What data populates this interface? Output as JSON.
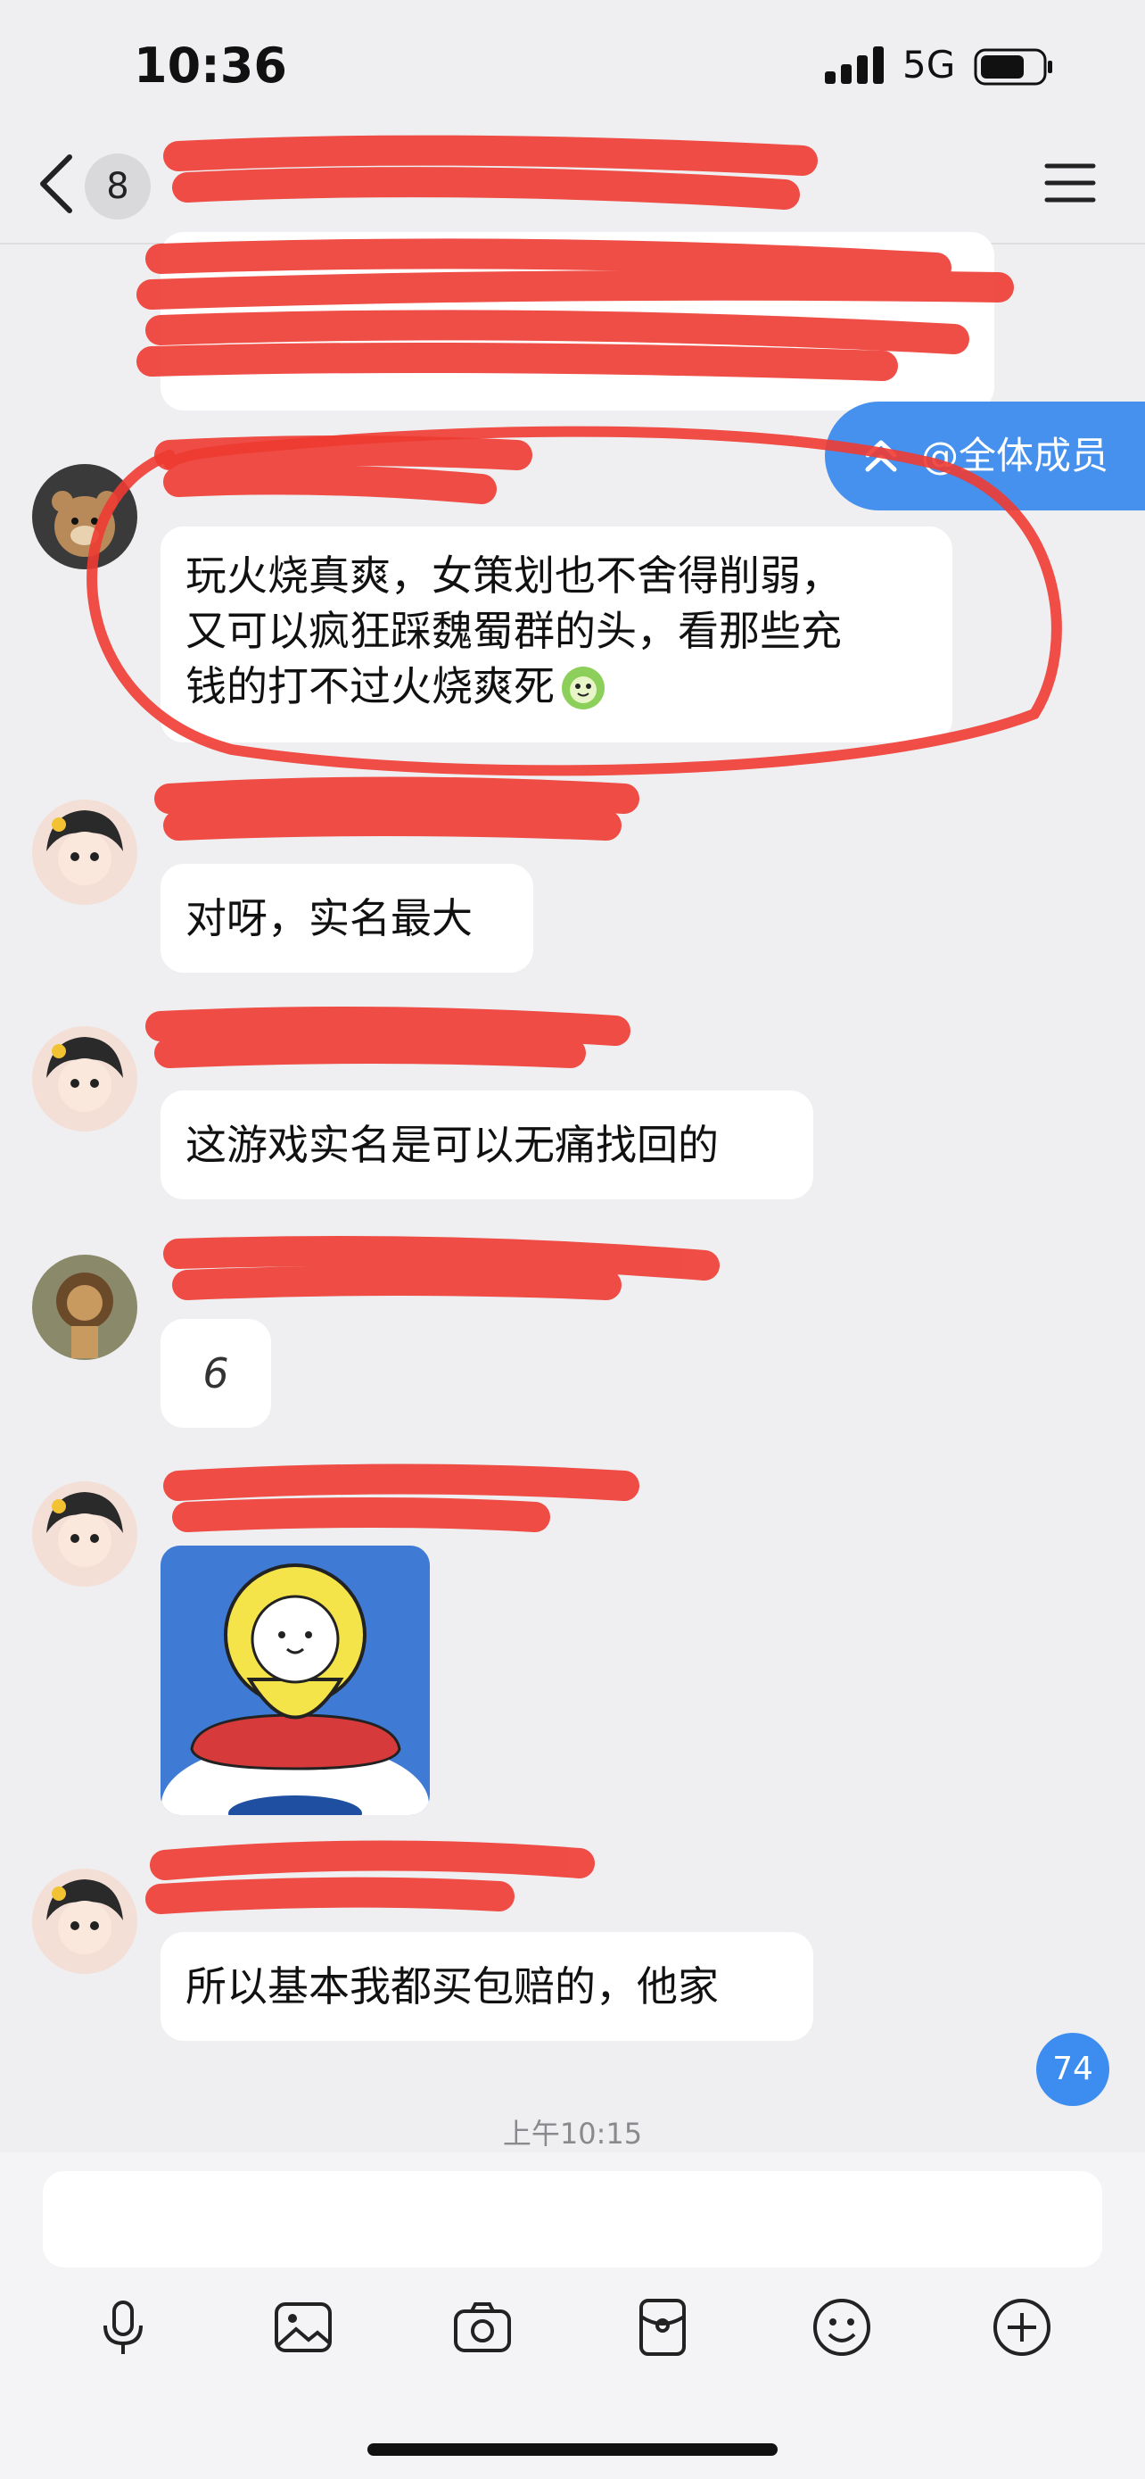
{
  "status_bar": {
    "time": "10:36",
    "network": "5G"
  },
  "header": {
    "unread_count": "8"
  },
  "messages": [
    {
      "text_line1": "玩火烧真爽，女策划也不舍得削弱，",
      "text_line2": "又可以疯狂踩魏蜀群的头，看那些充",
      "text_line3": "钱的打不过火烧爽死",
      "emoji": "cabbage-emoji"
    },
    {
      "text": "对呀，实名最大"
    },
    {
      "text": "这游戏实名是可以无痛找回的"
    },
    {
      "text": "6"
    },
    {
      "sticker": "yellow-ghost-on-ufo-sticker"
    },
    {
      "text": "所以基本我都买包赔的，他家"
    }
  ],
  "mention_pill": {
    "label": "@全体成员"
  },
  "unread_badge": "74",
  "timestamp": "上午10:15",
  "toolbar": [
    "mic-icon",
    "image-icon",
    "camera-icon",
    "red-packet-icon",
    "emoji-icon",
    "plus-icon"
  ],
  "colors": {
    "accent": "#4690ee",
    "redaction": "#ee3b32",
    "background": "#efeff1"
  }
}
